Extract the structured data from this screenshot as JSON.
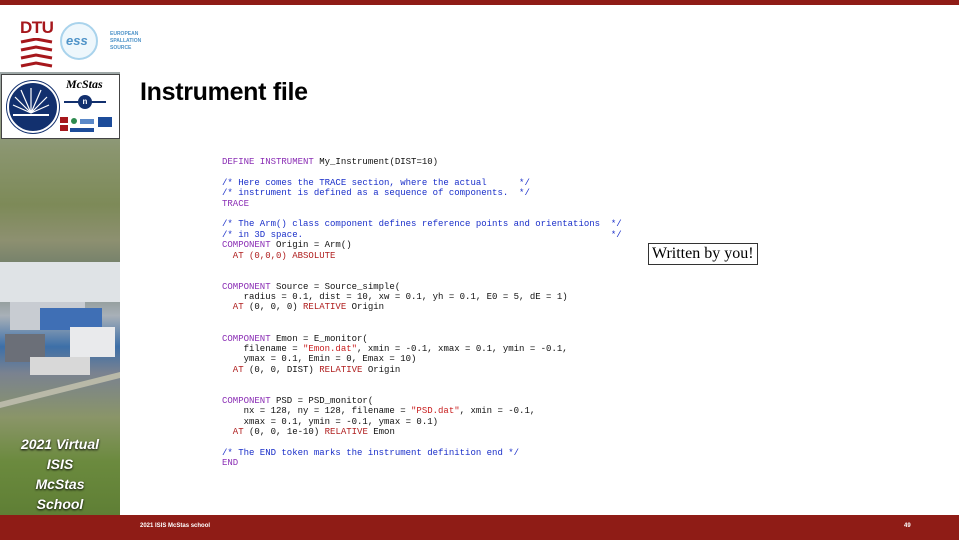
{
  "title": "Instrument file",
  "footer": {
    "left": "2021 ISIS McStas school",
    "page": "49"
  },
  "logos": {
    "dtu": "DTU",
    "ess_mark": "ess",
    "ess_words": [
      "EUROPEAN",
      "SPALLATION",
      "SOURCE"
    ],
    "mcstas": "McStas",
    "neutron_symbol": "n"
  },
  "sidebar_label": [
    "2021 Virtual",
    "ISIS",
    "McStas",
    "School"
  ],
  "callout": "Written by you!",
  "code_lines": [
    [
      {
        "t": "DEFINE INSTRUMENT",
        "c": "kw"
      },
      {
        "t": " My_Instrument(DIST=10)",
        "c": ""
      }
    ],
    [],
    [
      {
        "t": "/* Here comes the TRACE section, where the actual      */",
        "c": "cm"
      }
    ],
    [
      {
        "t": "/* instrument is defined as a sequence of components.  */",
        "c": "cm"
      }
    ],
    [
      {
        "t": "TRACE",
        "c": "kw"
      }
    ],
    [],
    [
      {
        "t": "/* The Arm() class component defines reference points and orientations  */",
        "c": "cm"
      }
    ],
    [
      {
        "t": "/* in 3D space.                                                         */",
        "c": "cm"
      }
    ],
    [
      {
        "t": "COMPONENT",
        "c": "kw"
      },
      {
        "t": " Origin = Arm()",
        "c": ""
      }
    ],
    [
      {
        "t": "  AT (0,0,0) ",
        "c": "ab"
      },
      {
        "t": "ABSOLUTE",
        "c": "ab"
      }
    ],
    [],
    [],
    [
      {
        "t": "COMPONENT",
        "c": "kw"
      },
      {
        "t": " Source = Source_simple(",
        "c": ""
      }
    ],
    [
      {
        "t": "    radius = 0.1, dist = 10, xw = 0.1, yh = 0.1, E0 = 5, dE = 1)",
        "c": ""
      }
    ],
    [
      {
        "t": "  AT ",
        "c": "ab"
      },
      {
        "t": "(0, 0, 0) ",
        "c": ""
      },
      {
        "t": "RELATIVE",
        "c": "ab"
      },
      {
        "t": " Origin",
        "c": ""
      }
    ],
    [],
    [],
    [
      {
        "t": "COMPONENT",
        "c": "kw"
      },
      {
        "t": " Emon = E_monitor(",
        "c": ""
      }
    ],
    [
      {
        "t": "    filename = ",
        "c": ""
      },
      {
        "t": "\"Emon.dat\"",
        "c": "st"
      },
      {
        "t": ", xmin = -0.1, xmax = 0.1, ymin = -0.1,",
        "c": ""
      }
    ],
    [
      {
        "t": "    ymax = 0.1, Emin = 0, Emax = 10)",
        "c": ""
      }
    ],
    [
      {
        "t": "  AT ",
        "c": "ab"
      },
      {
        "t": "(0, 0, DIST) ",
        "c": ""
      },
      {
        "t": "RELATIVE",
        "c": "ab"
      },
      {
        "t": " Origin",
        "c": ""
      }
    ],
    [],
    [],
    [
      {
        "t": "COMPONENT",
        "c": "kw"
      },
      {
        "t": " PSD = PSD_monitor(",
        "c": ""
      }
    ],
    [
      {
        "t": "    nx = 128, ny = 128, filename = ",
        "c": ""
      },
      {
        "t": "\"PSD.dat\"",
        "c": "st"
      },
      {
        "t": ", xmin = -0.1,",
        "c": ""
      }
    ],
    [
      {
        "t": "    xmax = 0.1, ymin = -0.1, ymax = 0.1)",
        "c": ""
      }
    ],
    [
      {
        "t": "  AT ",
        "c": "ab"
      },
      {
        "t": "(0, 0, 1e-10) ",
        "c": ""
      },
      {
        "t": "RELATIVE",
        "c": "ab"
      },
      {
        "t": " Emon",
        "c": ""
      }
    ],
    [],
    [
      {
        "t": "/* The END token marks the instrument definition end */",
        "c": "cm"
      }
    ],
    [
      {
        "t": "END",
        "c": "kw"
      }
    ]
  ]
}
